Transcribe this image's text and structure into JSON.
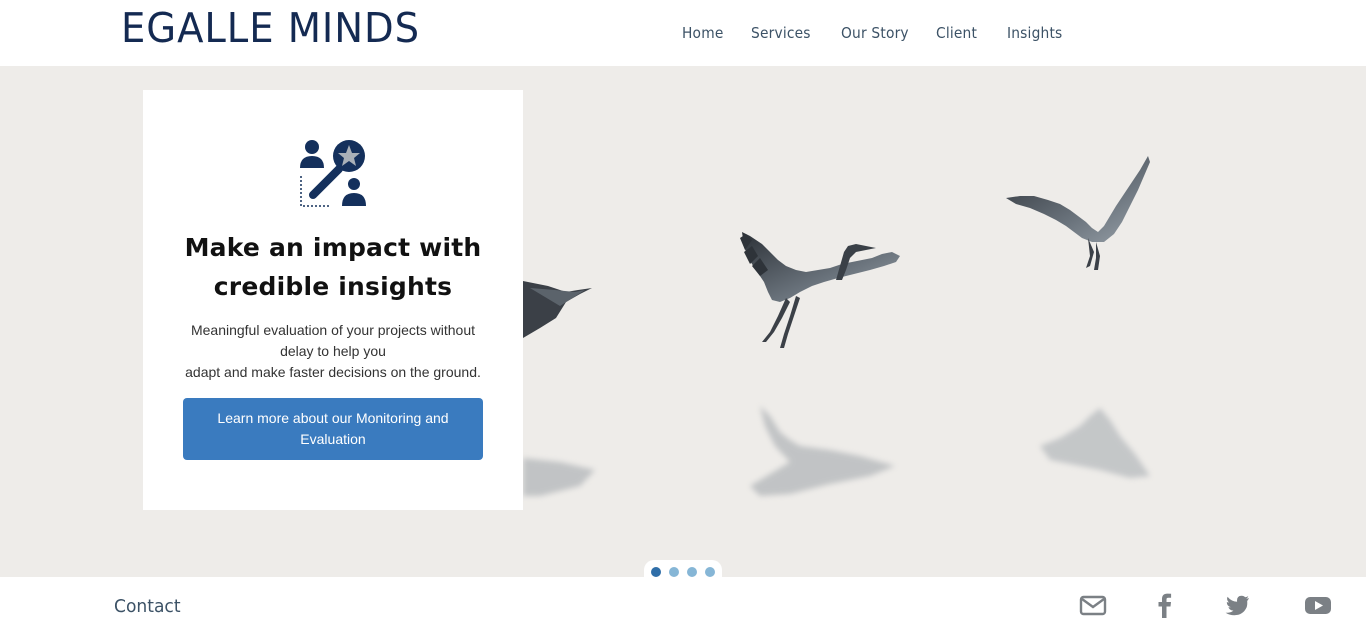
{
  "brand": {
    "name": "EGALLE MINDS",
    "color": "#142a52"
  },
  "nav": {
    "items": [
      {
        "label": "Home"
      },
      {
        "label": "Services"
      },
      {
        "label": "Our Story"
      },
      {
        "label": "Client"
      },
      {
        "label": "Insights"
      }
    ]
  },
  "hero": {
    "background": "#eeece9",
    "image": "flying-herons-reflection",
    "card": {
      "icon": "people-star-magnifier-icon",
      "title": "Make an impact with credible insights",
      "description": {
        "line1": "Meaningful evaluation of your projects without delay to help you",
        "line2": "adapt and make faster decisions on the ground."
      },
      "button_label": "Learn more about our Monitoring and Evaluation",
      "button_color": "#3a7bbf"
    },
    "slider": {
      "active_index": 0,
      "count": 4,
      "active_color": "#2f6ea8",
      "inactive_color": "#86b6d6"
    }
  },
  "footer": {
    "contact_label": "Contact",
    "social": [
      {
        "icon": "email-icon"
      },
      {
        "icon": "facebook-icon"
      },
      {
        "icon": "twitter-icon"
      },
      {
        "icon": "youtube-icon"
      }
    ],
    "social_color": "#7b8085"
  }
}
